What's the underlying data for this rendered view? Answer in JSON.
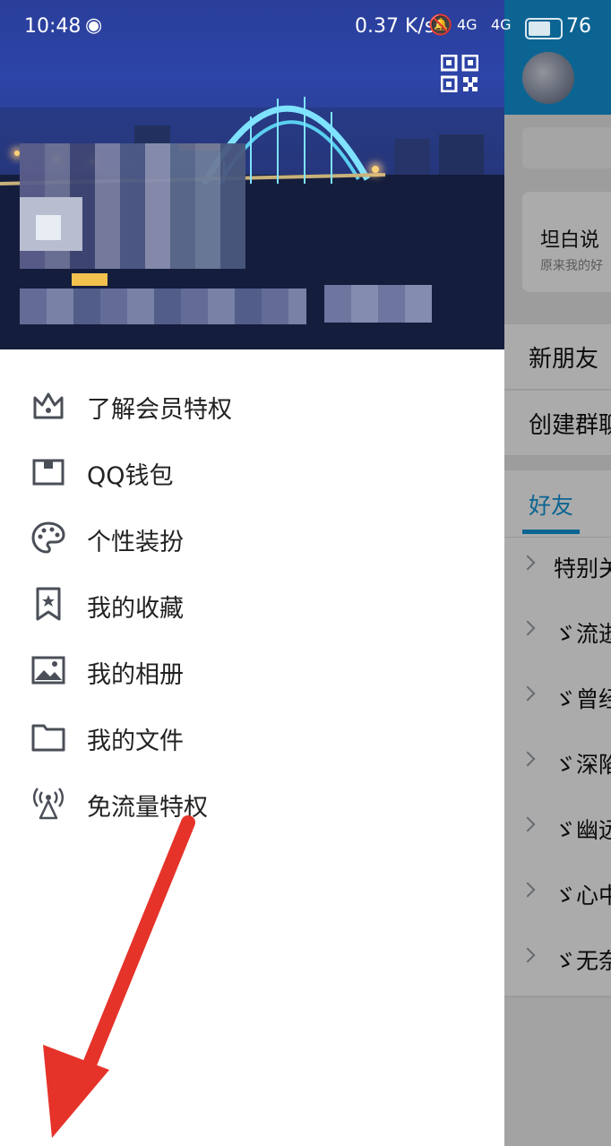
{
  "status_bar": {
    "time": "10:48",
    "net_speed": "0.37 K/s",
    "signal_1": "4G",
    "signal_2": "4G",
    "battery": "76"
  },
  "drawer": {
    "menu": [
      {
        "label": "了解会员特权",
        "icon": "crown-icon"
      },
      {
        "label": "QQ钱包",
        "icon": "wallet-icon"
      },
      {
        "label": "个性装扮",
        "icon": "palette-icon"
      },
      {
        "label": "我的收藏",
        "icon": "bookmark-star-icon"
      },
      {
        "label": "我的相册",
        "icon": "image-icon"
      },
      {
        "label": "我的文件",
        "icon": "folder-icon"
      },
      {
        "label": "免流量特权",
        "icon": "broadcast-tower-icon"
      }
    ]
  },
  "main": {
    "card_title": "坦白说",
    "card_subtitle": "原来我的好",
    "rows": [
      "新朋友",
      "创建群聊"
    ],
    "tab": "好友",
    "groups": [
      "特别关心",
      "ゞ流逝",
      "ゞ曾经",
      "ゞ深陷",
      "ゞ幽远",
      "ゞ心中",
      "ゞ无奈"
    ]
  },
  "colors": {
    "accent": "#1296db",
    "menu_text": "#222222",
    "icon": "#4a4e57",
    "arrow": "#e5332a"
  }
}
